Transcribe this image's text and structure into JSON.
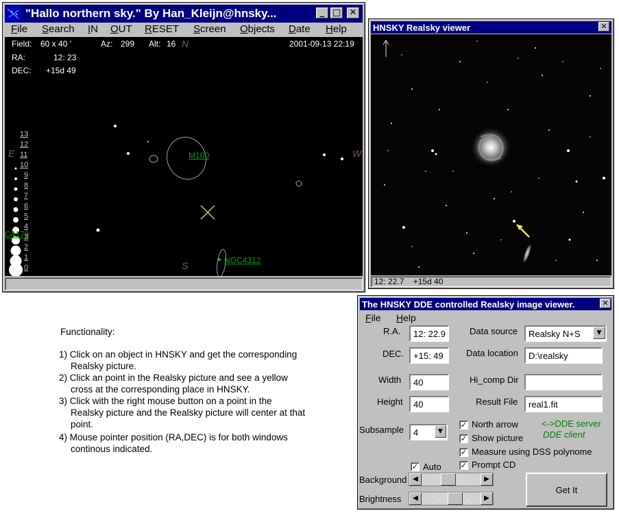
{
  "hnsky": {
    "title": "\"Hallo northern sky.\"  By Han_Kleijn@hnsky...",
    "menu": [
      "File",
      "Search",
      "IN",
      "OUT",
      "RESET",
      "Screen",
      "Objects",
      "Date",
      "Help"
    ],
    "menu_underline": [
      "F",
      "S",
      "I",
      "O",
      "R",
      "S",
      "O",
      "D",
      "H"
    ],
    "info": {
      "field_label": "Field:",
      "field_value": "60  x   40 '",
      "az_label": "Az:",
      "az_value": "299",
      "alt_label": "Alt:",
      "alt_value": "16",
      "ra_label": "RA:",
      "ra_value": "12: 23",
      "dec_label": "DEC:",
      "dec_value": "+15d 49",
      "datetime": "2001-09-13  22:19"
    },
    "compass": {
      "n": "N",
      "e": "E",
      "w": "W",
      "s": "S"
    },
    "objects": {
      "m100": "M100",
      "ngc4312": "NGC4312",
      "c4178": "C4178"
    },
    "mag_scale": [
      "13",
      "12",
      "11",
      "10",
      "9",
      "8",
      "7",
      "6",
      "5",
      "4",
      "3",
      "2",
      "1",
      "0"
    ]
  },
  "realsky": {
    "title": "HNSKY Realsky viewer",
    "status": "12: 22.7    +15d 40"
  },
  "dde": {
    "title": "The HNSKY DDE controlled Realsky image viewer.",
    "menu": [
      "File",
      "Help"
    ],
    "ra_label": "R.A.",
    "ra_value": "12: 22.9",
    "dec_label": "DEC.",
    "dec_value": "+15: 49",
    "width_label": "Width",
    "width_value": "40",
    "height_label": "Height",
    "height_value": "40",
    "subsample_label": "Subsample",
    "subsample_value": "4",
    "datasource_label": "Data source",
    "datasource_value": "Realsky N+S",
    "datalocation_label": "Data location",
    "datalocation_value": "D:\\realsky",
    "hicomp_label": "Hi_comp Dir",
    "hicomp_value": "",
    "result_label": "Result File",
    "result_value": "real1.fit",
    "north_arrow": "North arrow",
    "show_picture": "Show picture",
    "measure_dss": "Measure using DSS polynome",
    "prompt_cd": "Prompt CD",
    "auto": "Auto",
    "dde_server": "<->DDE server",
    "dde_client": "DDE client",
    "background_label": "Background",
    "brightness_label": "Brightness",
    "getit": "Get It"
  },
  "description": {
    "heading": "Functionality:",
    "items": [
      [
        "1) Click on an object in HNSKY and get the corresponding",
        "Realsky picture."
      ],
      [
        "2) Click an point in the Realsky picture and see a yellow",
        "cross at the corresponding place in HNSKY."
      ],
      [
        "3) Click with the right mouse button on a point in the",
        "Realsky picture and the Realsky picture will center at that",
        "point."
      ],
      [
        "4) Mouse pointer position (RA,DEC) is for both windows",
        "continous indicated."
      ]
    ]
  },
  "colors": {
    "titlebar": "#000080",
    "chrome": "#c0c0c0",
    "object_green": "#00a000",
    "compass_orange": "#806040",
    "dde_green": "#008000"
  }
}
